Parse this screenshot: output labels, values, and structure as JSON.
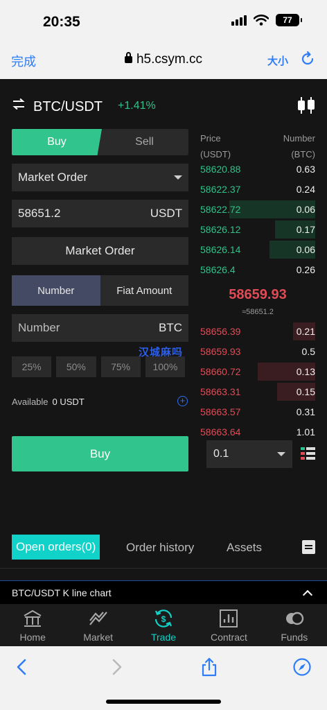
{
  "status_bar": {
    "time": "20:35",
    "battery": "77"
  },
  "browser": {
    "done_label": "完成",
    "url": "h5.csym.cc",
    "text_size_label": "大小"
  },
  "pair": {
    "name": "BTC/USDT",
    "change": "+1.41%"
  },
  "trade_form": {
    "buy_tab": "Buy",
    "sell_tab": "Sell",
    "order_type": "Market Order",
    "price_value": "58651.2",
    "price_unit": "USDT",
    "market_order_label": "Market Order",
    "number_tab": "Number",
    "fiat_tab": "Fiat Amount",
    "number_placeholder": "Number",
    "number_unit": "BTC",
    "watermark": "汉城麻吗",
    "percent_buttons": [
      "25%",
      "50%",
      "75%",
      "100%"
    ],
    "available_label": "Available",
    "available_value": "0 USDT",
    "buy_button": "Buy"
  },
  "order_book": {
    "price_header": "Price",
    "price_unit": "(USDT)",
    "number_header": "Number",
    "number_unit": "(BTC)",
    "bids": [
      {
        "price": "58620.88",
        "qty": "0.63",
        "depth": 0
      },
      {
        "price": "58622.37",
        "qty": "0.24",
        "depth": 0
      },
      {
        "price": "58622.72",
        "qty": "0.06",
        "depth": 0.75
      },
      {
        "price": "58626.12",
        "qty": "0.17",
        "depth": 0.35
      },
      {
        "price": "58626.14",
        "qty": "0.06",
        "depth": 0.4
      },
      {
        "price": "58626.4",
        "qty": "0.26",
        "depth": 0
      }
    ],
    "last_price": "58659.93",
    "index_price": "≈58651.2",
    "asks": [
      {
        "price": "58656.39",
        "qty": "0.21",
        "depth": 0.19
      },
      {
        "price": "58659.93",
        "qty": "0.5",
        "depth": 0
      },
      {
        "price": "58660.72",
        "qty": "0.13",
        "depth": 0.5
      },
      {
        "price": "58663.31",
        "qty": "0.15",
        "depth": 0.33
      },
      {
        "price": "58663.57",
        "qty": "0.31",
        "depth": 0
      },
      {
        "price": "58663.64",
        "qty": "1.01",
        "depth": 0
      }
    ],
    "precision": "0.1"
  },
  "orders": {
    "open_tab": "Open orders(0)",
    "history_tab": "Order history",
    "assets_tab": "Assets"
  },
  "kline_bar": {
    "label": "BTC/USDT K line chart"
  },
  "bottom_nav": [
    {
      "label": "Home",
      "icon": "home-icon"
    },
    {
      "label": "Market",
      "icon": "market-icon"
    },
    {
      "label": "Trade",
      "icon": "trade-icon",
      "active": true
    },
    {
      "label": "Contract",
      "icon": "contract-icon"
    },
    {
      "label": "Funds",
      "icon": "funds-icon"
    }
  ],
  "colors": {
    "buy_green": "#31c48d",
    "sell_red": "#e14b56",
    "accent_teal": "#10d2c8",
    "link_blue": "#2f7df6"
  }
}
